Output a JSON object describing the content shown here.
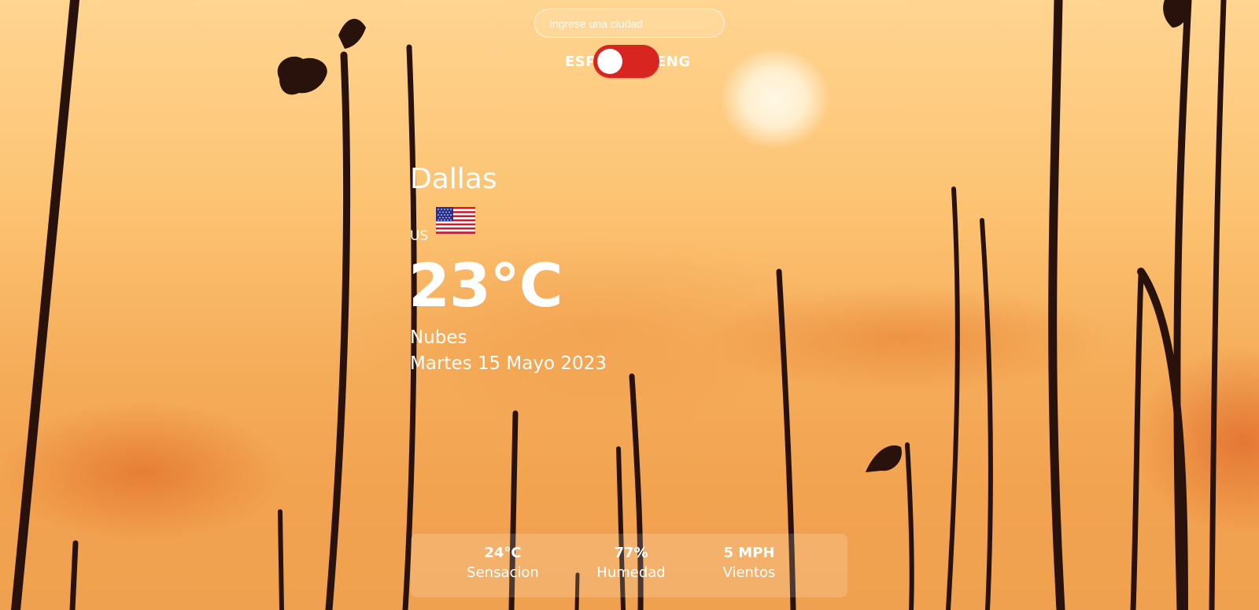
{
  "search": {
    "placeholder": "Ingrese una ciudad"
  },
  "language": {
    "left_label": "ESP",
    "right_label": "ENG"
  },
  "weather": {
    "city": "Dallas",
    "country_code": "US",
    "temperature": "23°C",
    "description": "Nubes",
    "date": "Martes 15 Mayo 2023"
  },
  "stats": [
    {
      "value": "24°C",
      "label": "Sensacion"
    },
    {
      "value": "77%",
      "label": "Humedad"
    },
    {
      "value": "5 MPH",
      "label": "Vientos"
    }
  ],
  "colors": {
    "toggle": "#d9251f",
    "text": "#ffffff"
  },
  "icons": {
    "flag": "us-flag-icon"
  }
}
